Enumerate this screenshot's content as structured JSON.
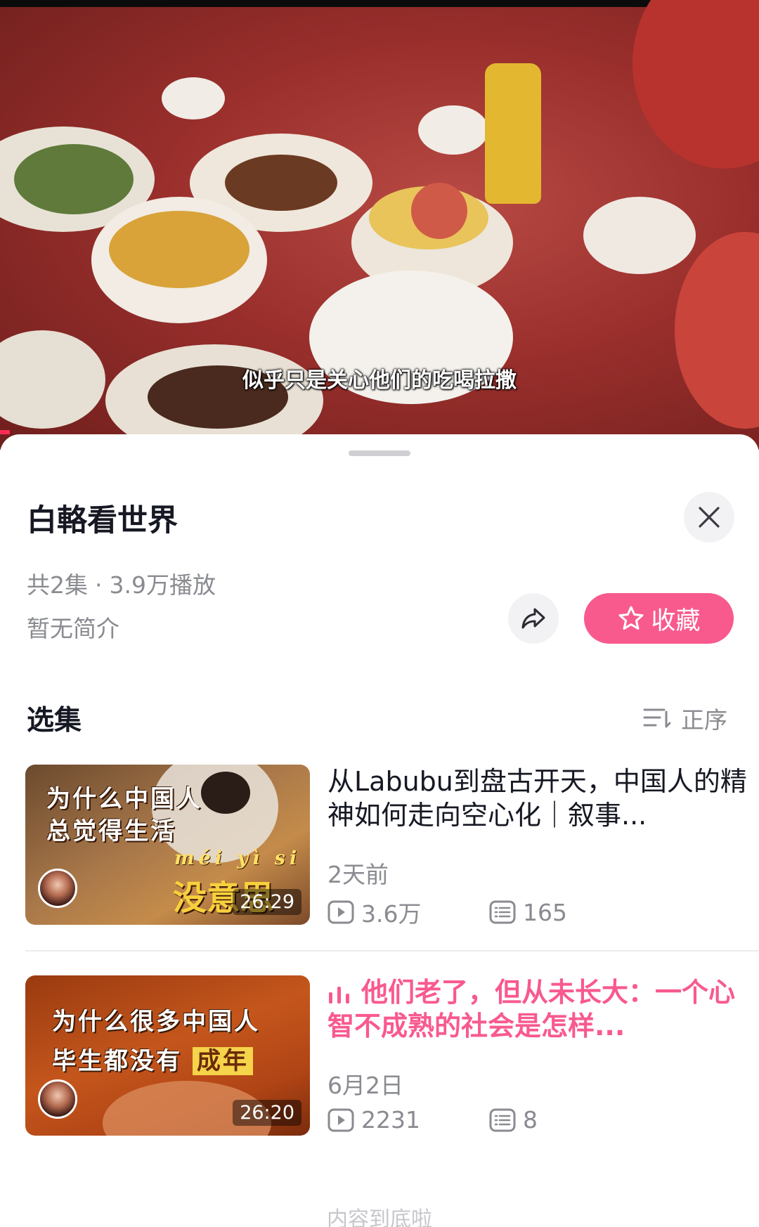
{
  "video": {
    "subtitle": "似乎只是关心他们的吃喝拉撒",
    "progress_fraction": 0.013
  },
  "sheet": {
    "title": "白輅看世界",
    "meta": {
      "episodes": "共2集",
      "separator": "·",
      "plays": "3.9万播放"
    },
    "description": "暂无简介",
    "favorite_label": "收藏",
    "section_title": "选集",
    "sort_label": "正序",
    "footer": "内容到底啦"
  },
  "episodes": [
    {
      "title": "从Labubu到盘古开天，中国人的精神如何走向空心化｜叙事...",
      "date": "2天前",
      "plays": "3.6万",
      "comments": "165",
      "duration": "26:29",
      "active": false,
      "thumb_line1": "为什么中国人",
      "thumb_line2": "总觉得生活",
      "thumb_pinyin": "méi yì si",
      "thumb_big": "没意思"
    },
    {
      "title": "他们老了，但从未长大：一个心智不成熟的社会是怎样...",
      "date": "6月2日",
      "plays": "2231",
      "comments": "8",
      "duration": "26:20",
      "active": true,
      "thumb_line1": "为什么很多中国人",
      "thumb_line2": "毕生都没有",
      "thumb_highlight": "成年"
    }
  ],
  "colors": {
    "accent": "#f85a8e",
    "text_primary": "#161823",
    "text_secondary": "#8a8b91"
  },
  "icons": {
    "close": "close-icon",
    "share": "share-icon",
    "favorite": "star-icon",
    "sort": "sort-icon",
    "plays": "play-icon",
    "comments": "comment-icon",
    "now_playing": "playing-bars-icon"
  }
}
